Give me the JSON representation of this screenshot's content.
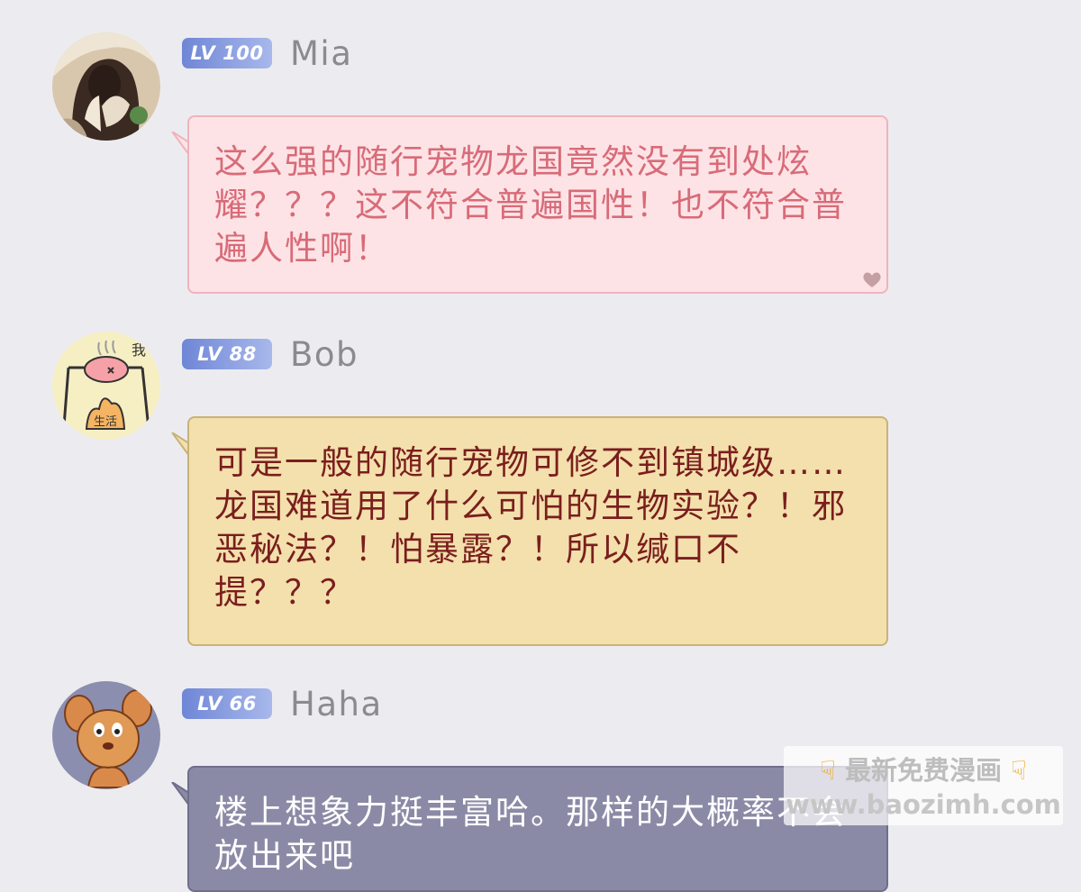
{
  "messages": [
    {
      "level": "LV 100",
      "username": "Mia",
      "text": "这么强的随行宠物龙国竟然没有到处炫耀？？？这不符合普遍国性！也不符合普遍人性啊！",
      "avatar_icon": "girl-portrait-avatar",
      "bubble_color": "#fde3e6"
    },
    {
      "level": "LV 88",
      "username": "Bob",
      "avatar_text": "生活",
      "avatar_text2": "我",
      "text": "可是一般的随行宠物可修不到镇城级……龙国难道用了什么可怕的生物实验？！邪恶秘法？！怕暴露？！所以缄口不提？？？",
      "avatar_icon": "roasting-pig-avatar",
      "bubble_color": "#f3e0ac"
    },
    {
      "level": "LV 66",
      "username": "Haha",
      "text": "楼上想象力挺丰富哈。那样的大概率不会放出来吧",
      "avatar_icon": "cartoon-mouse-avatar",
      "bubble_color": "#8b8aa6"
    }
  ],
  "watermark": {
    "line1": "最新免费漫画",
    "line2": "www.baozimh.com",
    "icon": "pointing-hand-icon"
  }
}
